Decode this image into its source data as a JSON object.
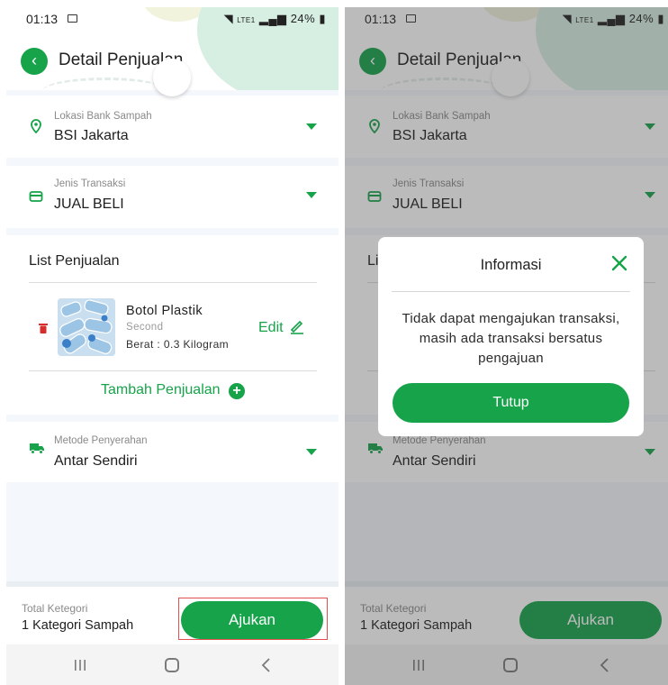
{
  "status_bar": {
    "time": "01:13",
    "net_label": "LTE1",
    "battery": "24%"
  },
  "header": {
    "title": "Detail Penjualan"
  },
  "fields": {
    "location": {
      "label": "Lokasi Bank Sampah",
      "value": "BSI Jakarta"
    },
    "transaction": {
      "label": "Jenis Transaksi",
      "value": "JUAL BELI"
    },
    "handover": {
      "label": "Metode Penyerahan",
      "value": "Antar Sendiri"
    }
  },
  "list": {
    "title": "List Penjualan",
    "item": {
      "name": "Botol Plastik",
      "condition": "Second",
      "weight": "Berat : 0.3 Kilogram"
    },
    "edit_label": "Edit",
    "add_label": "Tambah Penjualan"
  },
  "footer": {
    "total_label": "Total Ketegori",
    "total_value": "1 Kategori Sampah",
    "submit_label": "Ajukan"
  },
  "modal": {
    "title": "Informasi",
    "message": "Tidak dapat mengajukan transaksi, masih ada transaksi bersatus pengajuan",
    "button_label": "Tutup"
  },
  "colors": {
    "accent": "#16a34a",
    "highlight": "#e05050",
    "background": "#f4f8fc"
  }
}
